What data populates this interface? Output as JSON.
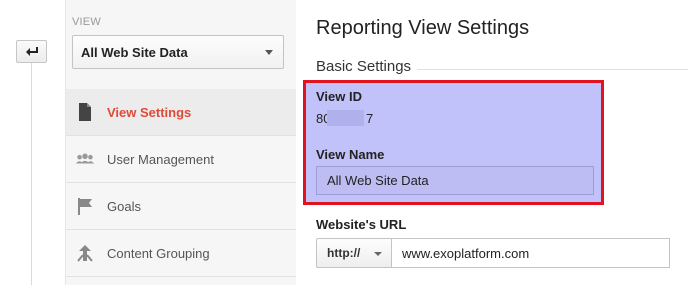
{
  "sidebar": {
    "view_label": "VIEW",
    "view_select_value": "All Web Site Data",
    "items": [
      {
        "label": "View Settings",
        "icon": "document-icon",
        "active": true
      },
      {
        "label": "User Management",
        "icon": "users-icon",
        "active": false
      },
      {
        "label": "Goals",
        "icon": "flag-icon",
        "active": false
      },
      {
        "label": "Content Grouping",
        "icon": "content-grouping-icon",
        "active": false
      }
    ]
  },
  "main": {
    "title": "Reporting View Settings",
    "section_title": "Basic Settings",
    "view_id_label": "View ID",
    "view_id_prefix": "80",
    "view_id_suffix": "7",
    "view_name_label": "View Name",
    "view_name_value": "All Web Site Data",
    "website_url_label": "Website's URL",
    "protocol_value": "http://",
    "website_url_value": "www.exoplatform.com"
  },
  "colors": {
    "accent_active": "#dd4b39",
    "highlight_border": "#e1131f",
    "highlight_fill": "#c2c2fb"
  }
}
